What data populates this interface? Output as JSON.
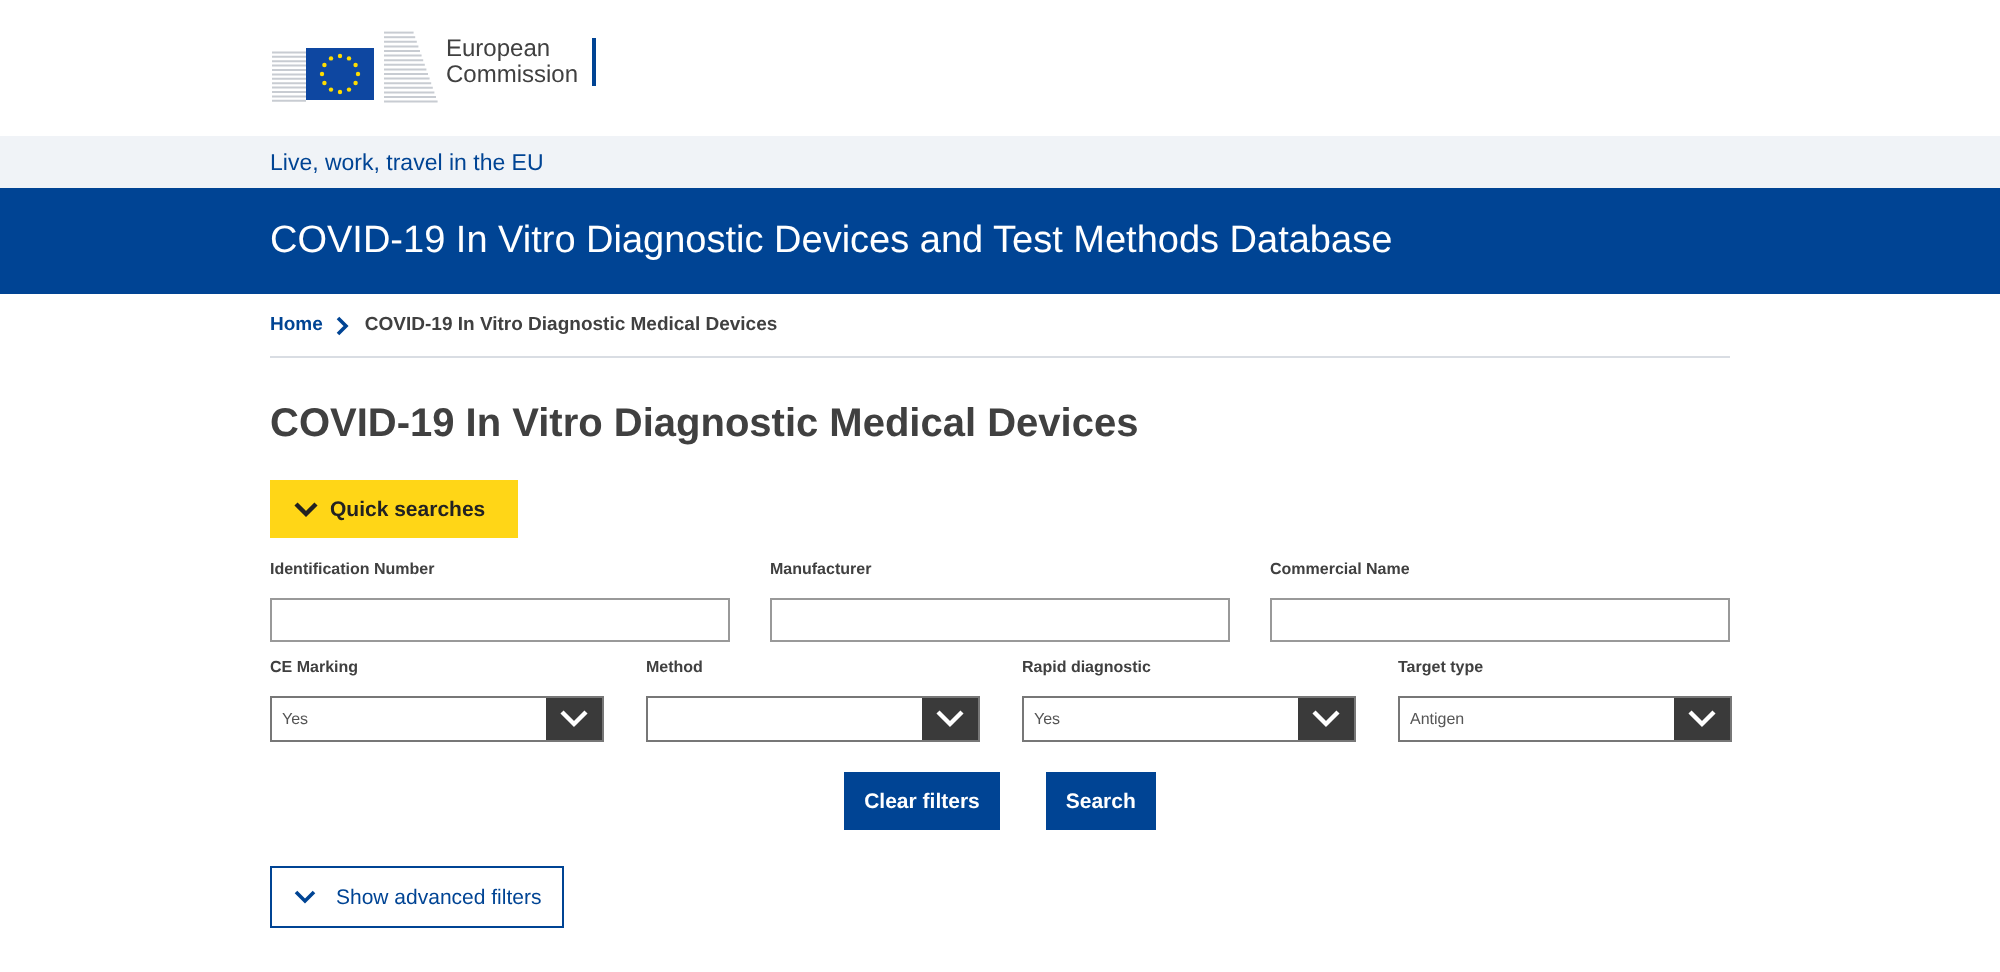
{
  "header": {
    "logo_text_line1": "European",
    "logo_text_line2": "Commission"
  },
  "site_bar": {
    "text": "Live, work, travel in the EU"
  },
  "banner": {
    "title": "COVID-19 In Vitro Diagnostic Devices and Test Methods Database"
  },
  "breadcrumb": [
    {
      "label": "Home",
      "kind": "link"
    },
    {
      "label": "COVID-19 In Vitro Diagnostic Medical Devices",
      "kind": "current"
    }
  ],
  "page_title": "COVID-19 In Vitro Diagnostic Medical Devices",
  "quick_searches": {
    "label": "Quick searches"
  },
  "text_fields": [
    {
      "label": "Identification Number"
    },
    {
      "label": "Manufacturer"
    },
    {
      "label": "Commercial Name"
    }
  ],
  "select_fields": [
    {
      "label": "CE Marking",
      "value": "Yes"
    },
    {
      "label": "Method"
    },
    {
      "label": "Rapid diagnostic",
      "value": "Yes"
    },
    {
      "label": "Target type",
      "value": "Antigen"
    }
  ],
  "buttons": [
    "Clear filters",
    "Search"
  ],
  "advanced_filters": {
    "label": "Show advanced filters"
  }
}
